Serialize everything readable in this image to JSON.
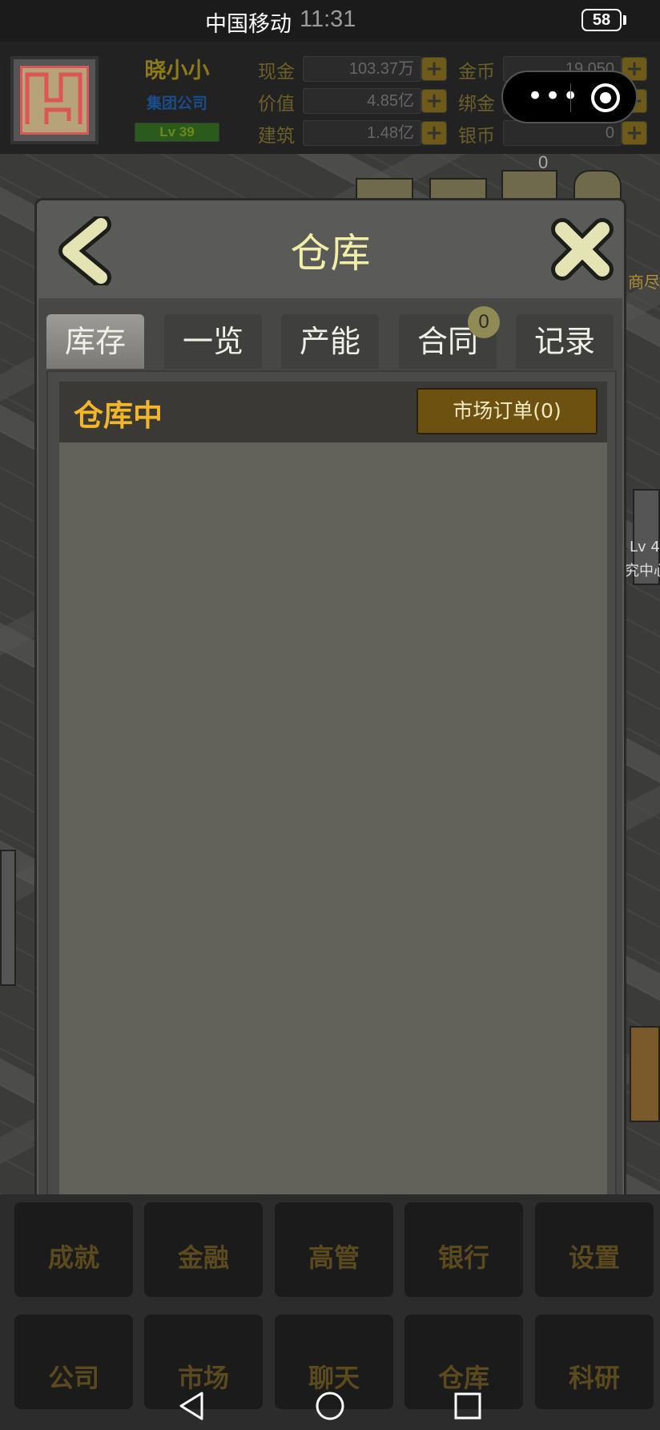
{
  "status_bar": {
    "carrier": "中国移动",
    "time": "11:31",
    "battery": "58"
  },
  "hud": {
    "player_name": "晓小小",
    "company_type": "集团公司",
    "level": "Lv 39",
    "resources": [
      {
        "label": "现金",
        "value": "103.37万"
      },
      {
        "label": "价值",
        "value": "4.85亿"
      },
      {
        "label": "建筑",
        "value": "1.48亿"
      },
      {
        "label": "金币",
        "value": "19,050"
      },
      {
        "label": "绑金",
        "value": ""
      },
      {
        "label": "银币",
        "value": "0"
      }
    ],
    "plus_symbol": "+"
  },
  "capsule": {
    "more_dots": "•••"
  },
  "map_badge": "0",
  "dialog": {
    "title": "仓库",
    "tabs": [
      {
        "label": "库存",
        "active": true
      },
      {
        "label": "一览",
        "active": false
      },
      {
        "label": "产能",
        "active": false
      },
      {
        "label": "合同",
        "active": false,
        "badge": "0"
      },
      {
        "label": "记录",
        "active": false
      }
    ],
    "section_title": "仓库中",
    "market_button": "市场订单(0)"
  },
  "dock": {
    "row1": [
      "成就",
      "金融",
      "高管",
      "银行",
      "设置"
    ],
    "row2": [
      "公司",
      "市场",
      "聊天",
      "仓库",
      "科研"
    ]
  },
  "background_labels": {
    "level_tag": "Lv 4",
    "building_name": "究中心",
    "right_hint": "商尽"
  },
  "colors": {
    "accent_gold": "#f2b62a",
    "title_cream": "#f1eea6",
    "market_button_bg": "#6c5110",
    "dock_text": "#5b4a1e"
  }
}
